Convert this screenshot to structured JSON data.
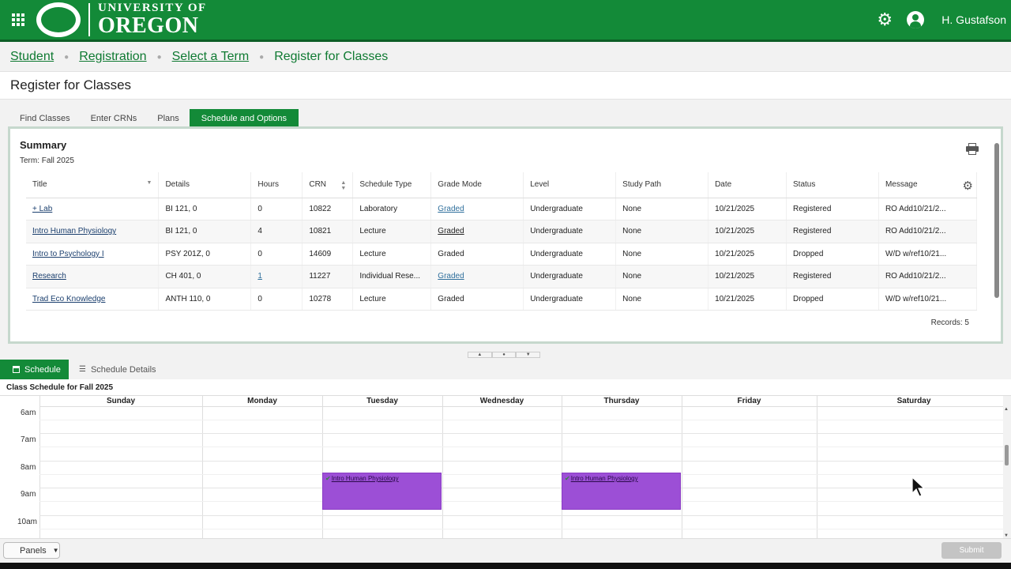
{
  "header": {
    "logo_line1": "UNIVERSITY OF",
    "logo_line2": "OREGON",
    "username": "H. Gustafson",
    "apps_icon": "apps-grid-icon",
    "settings_icon": "gear-icon",
    "user_icon": "user-avatar-icon",
    "brand_color": "#138a38"
  },
  "breadcrumb": {
    "items": [
      "Student",
      "Registration",
      "Select a Term"
    ],
    "current": "Register for Classes"
  },
  "page": {
    "title": "Register for Classes"
  },
  "tabs": [
    "Find Classes",
    "Enter CRNs",
    "Plans",
    "Schedule and Options"
  ],
  "summary": {
    "title": "Summary",
    "term": "Term:  Fall 2025",
    "columns": [
      "Title",
      "Details",
      "Hours",
      "CRN",
      "Schedule Type",
      "Grade Mode",
      "Level",
      "Study Path",
      "Date",
      "Status",
      "Message"
    ],
    "rows": [
      {
        "title": "+ Lab",
        "details": "BI 121, 0",
        "hours": "0",
        "crn": "10822",
        "schedule_type": "Laboratory",
        "grade_mode": "Graded",
        "level": "Undergraduate",
        "study_path": "None",
        "date": "10/21/2025",
        "status": "Registered",
        "message": "RO Add10/21/2..."
      },
      {
        "title": "Intro Human Physiology",
        "details": "BI 121, 0",
        "hours": "4",
        "crn": "10821",
        "schedule_type": "Lecture",
        "grade_mode": "Graded",
        "level": "Undergraduate",
        "study_path": "None",
        "date": "10/21/2025",
        "status": "Registered",
        "message": "RO Add10/21/2..."
      },
      {
        "title": "Intro to Psychology I",
        "details": "PSY 201Z, 0",
        "hours": "0",
        "crn": "14609",
        "schedule_type": "Lecture",
        "grade_mode": "Graded",
        "level": "Undergraduate",
        "study_path": "None",
        "date": "10/21/2025",
        "status": "Dropped",
        "message": "W/D w/ref10/21..."
      },
      {
        "title": "Research",
        "details": "CH 401, 0",
        "hours": "1",
        "crn": "11227",
        "schedule_type": "Individual Rese...",
        "grade_mode": "Graded",
        "level": "Undergraduate",
        "study_path": "None",
        "date": "10/21/2025",
        "status": "Registered",
        "message": "RO Add10/21/2..."
      },
      {
        "title": "Trad Eco Knowledge",
        "details": "ANTH 110, 0",
        "hours": "0",
        "crn": "10278",
        "schedule_type": "Lecture",
        "grade_mode": "Graded",
        "level": "Undergraduate",
        "study_path": "None",
        "date": "10/21/2025",
        "status": "Dropped",
        "message": "W/D w/ref10/21..."
      }
    ],
    "records": "Records: 5"
  },
  "schedule": {
    "tab_schedule": "Schedule",
    "tab_details": "Schedule Details",
    "title": "Class Schedule for Fall 2025",
    "days": [
      "Sunday",
      "Monday",
      "Tuesday",
      "Wednesday",
      "Thursday",
      "Friday",
      "Saturday"
    ],
    "times": [
      "6am",
      "7am",
      "8am",
      "9am",
      "10am"
    ],
    "events": [
      {
        "day": "Tuesday",
        "title": "Intro Human Physiology",
        "start": "8:30",
        "end": "9:50"
      },
      {
        "day": "Thursday",
        "title": "Intro Human Physiology",
        "start": "8:30",
        "end": "9:50"
      }
    ],
    "event_color": "#9c4fd6"
  },
  "footer": {
    "panels": "Panels",
    "submit": "Submit"
  }
}
